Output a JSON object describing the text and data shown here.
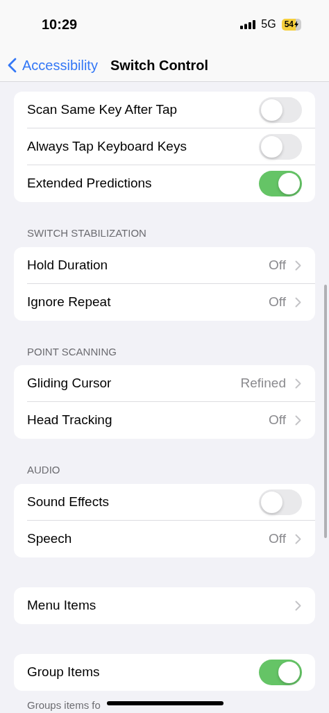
{
  "status_bar": {
    "time": "10:29",
    "network": "5G",
    "battery": "54"
  },
  "nav": {
    "back": "Accessibility",
    "title": "Switch Control"
  },
  "sections": [
    {
      "rows": [
        {
          "label": "Scan Same Key After Tap",
          "kind": "toggle",
          "on": false
        },
        {
          "label": "Always Tap Keyboard Keys",
          "kind": "toggle",
          "on": false
        },
        {
          "label": "Extended Predictions",
          "kind": "toggle",
          "on": true
        }
      ]
    },
    {
      "header": "SWITCH STABILIZATION",
      "rows": [
        {
          "label": "Hold Duration",
          "kind": "link",
          "value": "Off"
        },
        {
          "label": "Ignore Repeat",
          "kind": "link",
          "value": "Off"
        }
      ]
    },
    {
      "header": "POINT SCANNING",
      "rows": [
        {
          "label": "Gliding Cursor",
          "kind": "link",
          "value": "Refined"
        },
        {
          "label": "Head Tracking",
          "kind": "link",
          "value": "Off"
        }
      ]
    },
    {
      "header": "AUDIO",
      "rows": [
        {
          "label": "Sound Effects",
          "kind": "toggle",
          "on": false
        },
        {
          "label": "Speech",
          "kind": "link",
          "value": "Off"
        }
      ]
    },
    {
      "rows": [
        {
          "label": "Menu Items",
          "kind": "link"
        }
      ]
    },
    {
      "rows": [
        {
          "label": "Group Items",
          "kind": "toggle",
          "on": true
        }
      ],
      "footer": "Groups items fo"
    }
  ]
}
